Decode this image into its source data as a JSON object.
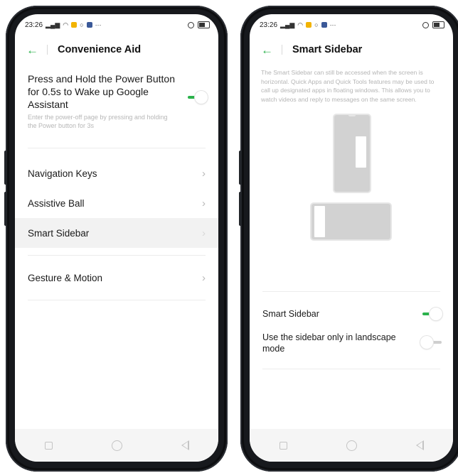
{
  "status_bar": {
    "time": "23:26",
    "extra": "···"
  },
  "left_screen": {
    "title": "Convenience Aid",
    "power_button": {
      "title": "Press and Hold the Power Button for 0.5s to Wake up Google Assistant",
      "description": "Enter the power-off page by pressing and holding the Power button for 3s",
      "toggle_on": true
    },
    "items": [
      {
        "label": "Navigation Keys"
      },
      {
        "label": "Assistive Ball"
      },
      {
        "label": "Smart Sidebar"
      },
      {
        "label": "Gesture & Motion"
      }
    ]
  },
  "right_screen": {
    "title": "Smart Sidebar",
    "description": "The Smart Sidebar can still be accessed when the screen is horizontal. Quick Apps and Quick Tools features may be used to call up designated apps in floating windows. This allows you to watch videos and reply to messages on the same screen.",
    "settings": [
      {
        "label": "Smart Sidebar",
        "toggle_on": true
      },
      {
        "label": "Use the sidebar only in landscape mode",
        "toggle_on": false
      }
    ]
  },
  "icons": {
    "back": "back-arrow-icon",
    "chevron": "chevron-right-icon",
    "nav_recent": "recent-apps-icon",
    "nav_home": "home-icon",
    "nav_back": "back-triangle-icon"
  },
  "colors": {
    "accent": "#2bb24c",
    "selected_row": "#f2f2f2",
    "phone_frame": "#17191d"
  }
}
